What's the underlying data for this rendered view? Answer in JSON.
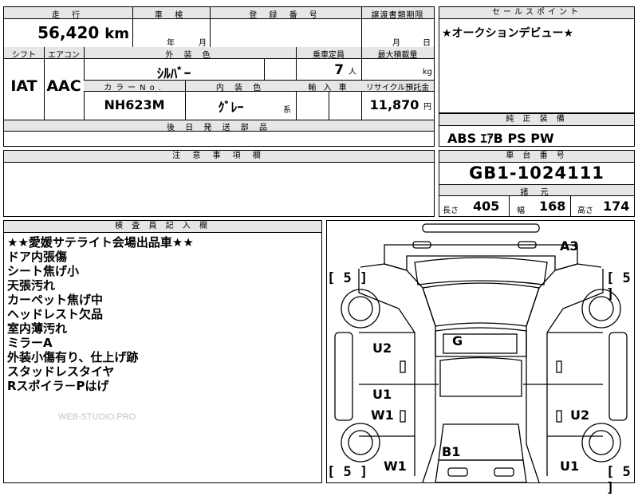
{
  "mileage": {
    "header": "走 行",
    "value": "56,420",
    "unit": "km"
  },
  "inspection": {
    "header": "車 検",
    "year_unit": "年",
    "month_unit": "月"
  },
  "registration": {
    "header": "登 録 番 号"
  },
  "transfer_deadline": {
    "header": "譲渡書類期限",
    "month_unit": "月",
    "day_unit": "日"
  },
  "sales_point": {
    "header": "セールスポイント",
    "text": "★オークションデビュー★"
  },
  "shift": {
    "header": "シフト",
    "value": "IAT"
  },
  "aircon": {
    "header": "エアコン",
    "value": "AAC"
  },
  "exterior_color": {
    "header": "外 装 色",
    "value": "ｼﾙﾊﾞｰ"
  },
  "capacity": {
    "header": "乗車定員",
    "value": "7",
    "unit": "人"
  },
  "max_load": {
    "header": "最大積載量",
    "unit": "kg"
  },
  "color_no": {
    "header": "カラーNo.",
    "value": "NH623M"
  },
  "interior_color": {
    "header": "内 装 色",
    "value": "ｸﾞﾚｰ",
    "suffix": "系"
  },
  "import": {
    "header": "輸 入 車"
  },
  "recycle_fee": {
    "header": "リサイクル預託金",
    "value": "11,870",
    "unit": "円"
  },
  "later_parts": {
    "header": "後 日 発 送 部 品"
  },
  "equipment": {
    "header": "純 正 装 備",
    "value": "ABS ｴｱB PS PW"
  },
  "caution": {
    "header": "注 意 事 項 欄"
  },
  "chassis": {
    "header": "車 台 番 号",
    "value": "GB1-1024111"
  },
  "specs": {
    "header": "諸 元",
    "length_label": "長さ",
    "length": "405",
    "width_label": "幅",
    "width": "168",
    "height_label": "高さ",
    "height": "174"
  },
  "inspector": {
    "header": "検 査 員 記 入 欄",
    "notes": [
      "★★愛媛サテライト会場出品車★★",
      "ドア内張傷",
      "シート焦げ小",
      "天張汚れ",
      "カーペット焦げ中",
      "ヘッドレスト欠品",
      "室内薄汚れ",
      "ミラーA",
      "外装小傷有り、仕上げ跡",
      "スタッドレスタイヤ",
      "Rスポイラ－Pはげ"
    ],
    "watermark": "WEB-STUDIO.PRO"
  },
  "diagram": {
    "marks": {
      "a3": "A3",
      "g": "G",
      "u2_left": "U2",
      "u1_left": "U1",
      "w1_left": "W1",
      "u2_right": "U2",
      "b1": "B1",
      "w1_bottom": "W1",
      "u1_bottom": "U1"
    },
    "tires": {
      "tl": "5",
      "tr": "5",
      "bl": "5",
      "br": "5"
    }
  }
}
